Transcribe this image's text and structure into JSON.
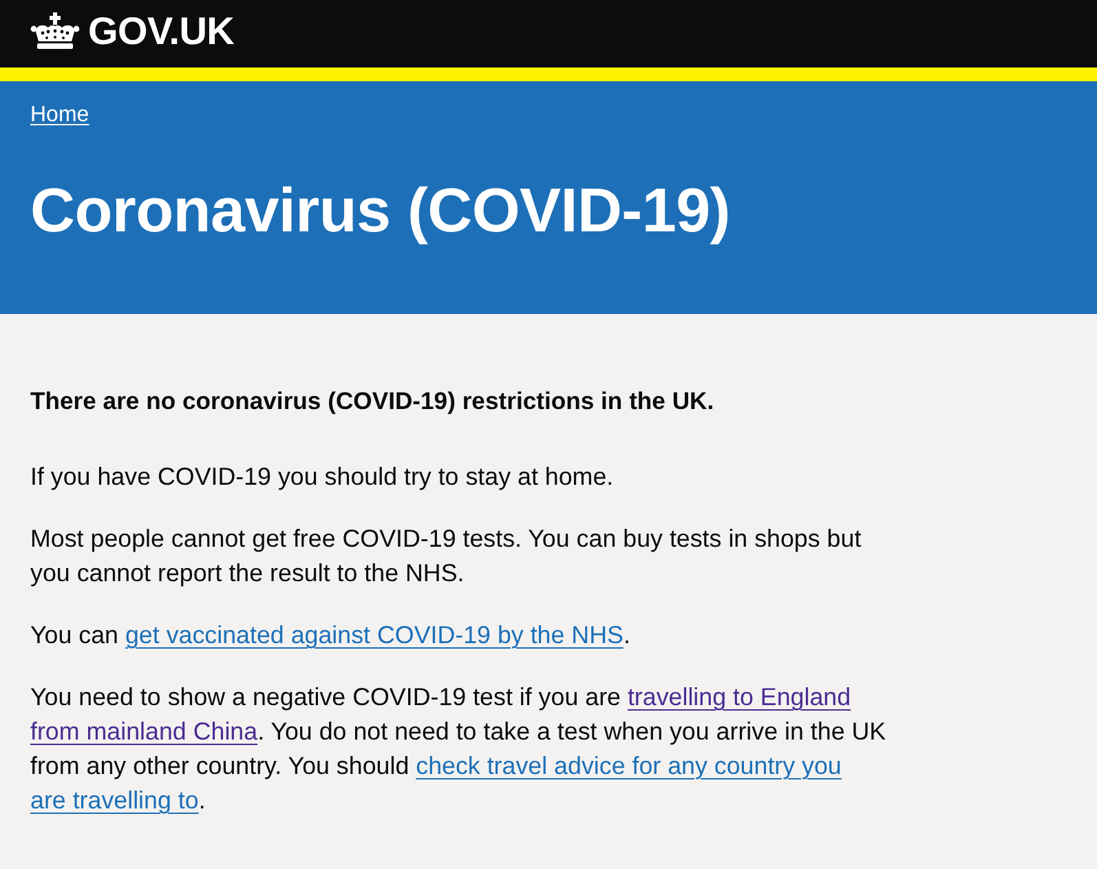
{
  "header": {
    "logo_text": "GOV.UK"
  },
  "banner": {
    "breadcrumb": "Home",
    "title": "Coronavirus (COVID-19)"
  },
  "content": {
    "lead": "There are no coronavirus (COVID-19) restrictions in the UK.",
    "paragraphs": [
      {
        "lines": [
          [
            {
              "kind": "text",
              "text": "If you have COVID-19 you should try to stay at home."
            }
          ]
        ]
      },
      {
        "lines": [
          [
            {
              "kind": "text",
              "text": "Most people cannot get free COVID-19 tests. You can buy tests in shops but"
            }
          ],
          [
            {
              "kind": "text",
              "text": "you cannot report the result to the NHS."
            }
          ]
        ]
      },
      {
        "lines": [
          [
            {
              "kind": "text",
              "text": "You can "
            },
            {
              "kind": "link",
              "text": "get vaccinated against COVID-19 by the NHS",
              "visited": false
            },
            {
              "kind": "text",
              "text": "."
            }
          ]
        ]
      },
      {
        "lines": [
          [
            {
              "kind": "text",
              "text": "You need to show a negative COVID-19 test if you are "
            },
            {
              "kind": "link",
              "text": "travelling to England",
              "visited": true
            }
          ],
          [
            {
              "kind": "link",
              "text": "from mainland China",
              "visited": true
            },
            {
              "kind": "text",
              "text": ". You do not need to take a test when you arrive in the UK"
            }
          ],
          [
            {
              "kind": "text",
              "text": "from any other country. You should "
            },
            {
              "kind": "link",
              "text": "check travel advice for any country you",
              "visited": false
            }
          ],
          [
            {
              "kind": "link",
              "text": "are travelling to",
              "visited": false
            },
            {
              "kind": "text",
              "text": "."
            }
          ]
        ]
      }
    ]
  }
}
